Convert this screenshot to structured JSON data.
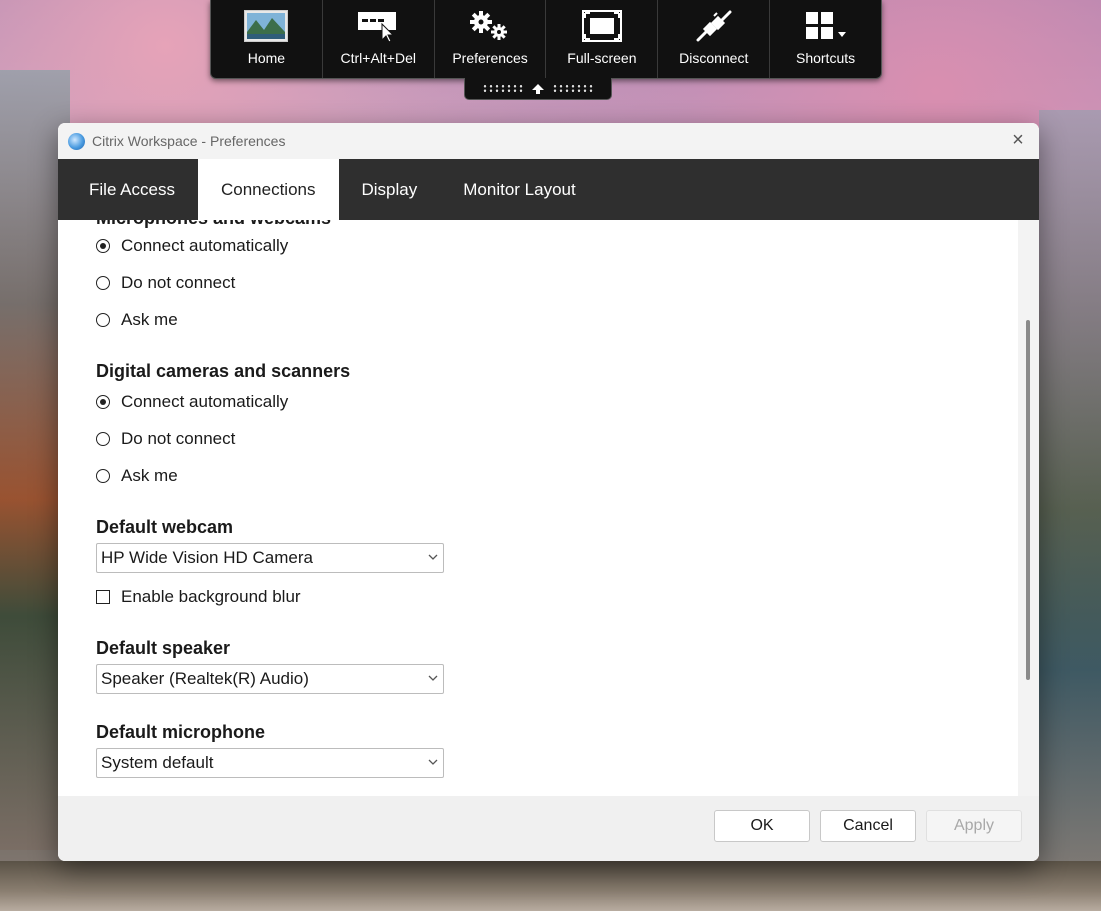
{
  "toolbar": {
    "items": [
      {
        "label": "Home",
        "icon": "home-icon"
      },
      {
        "label": "Ctrl+Alt+Del",
        "icon": "ctrl-alt-del-icon"
      },
      {
        "label": "Preferences",
        "icon": "gears-icon"
      },
      {
        "label": "Full-screen",
        "icon": "fullscreen-icon"
      },
      {
        "label": "Disconnect",
        "icon": "disconnect-plug-icon"
      },
      {
        "label": "Shortcuts",
        "icon": "shortcuts-grid-icon"
      }
    ]
  },
  "window": {
    "title": "Citrix Workspace - Preferences",
    "tabs": [
      {
        "label": "File Access",
        "active": false
      },
      {
        "label": "Connections",
        "active": true
      },
      {
        "label": "Display",
        "active": false
      },
      {
        "label": "Monitor Layout",
        "active": false
      }
    ]
  },
  "connections": {
    "mic_section_title": "Microphones and webcams",
    "mic_options": [
      "Connect automatically",
      "Do not connect",
      "Ask me"
    ],
    "mic_selected": 0,
    "camera_section_title": "Digital cameras and scanners",
    "camera_options": [
      "Connect automatically",
      "Do not connect",
      "Ask me"
    ],
    "camera_selected": 0,
    "webcam_title": "Default webcam",
    "webcam_value": "HP Wide Vision HD Camera",
    "blur_label": "Enable background blur",
    "blur_checked": false,
    "speaker_title": "Default speaker",
    "speaker_value": "Speaker (Realtek(R) Audio)",
    "microphone_title": "Default microphone",
    "microphone_value": "System default"
  },
  "footer": {
    "ok_label": "OK",
    "cancel_label": "Cancel",
    "apply_label": "Apply"
  },
  "colors": {
    "tab_bar": "#2f2f2f",
    "toolbar": "#111111"
  }
}
